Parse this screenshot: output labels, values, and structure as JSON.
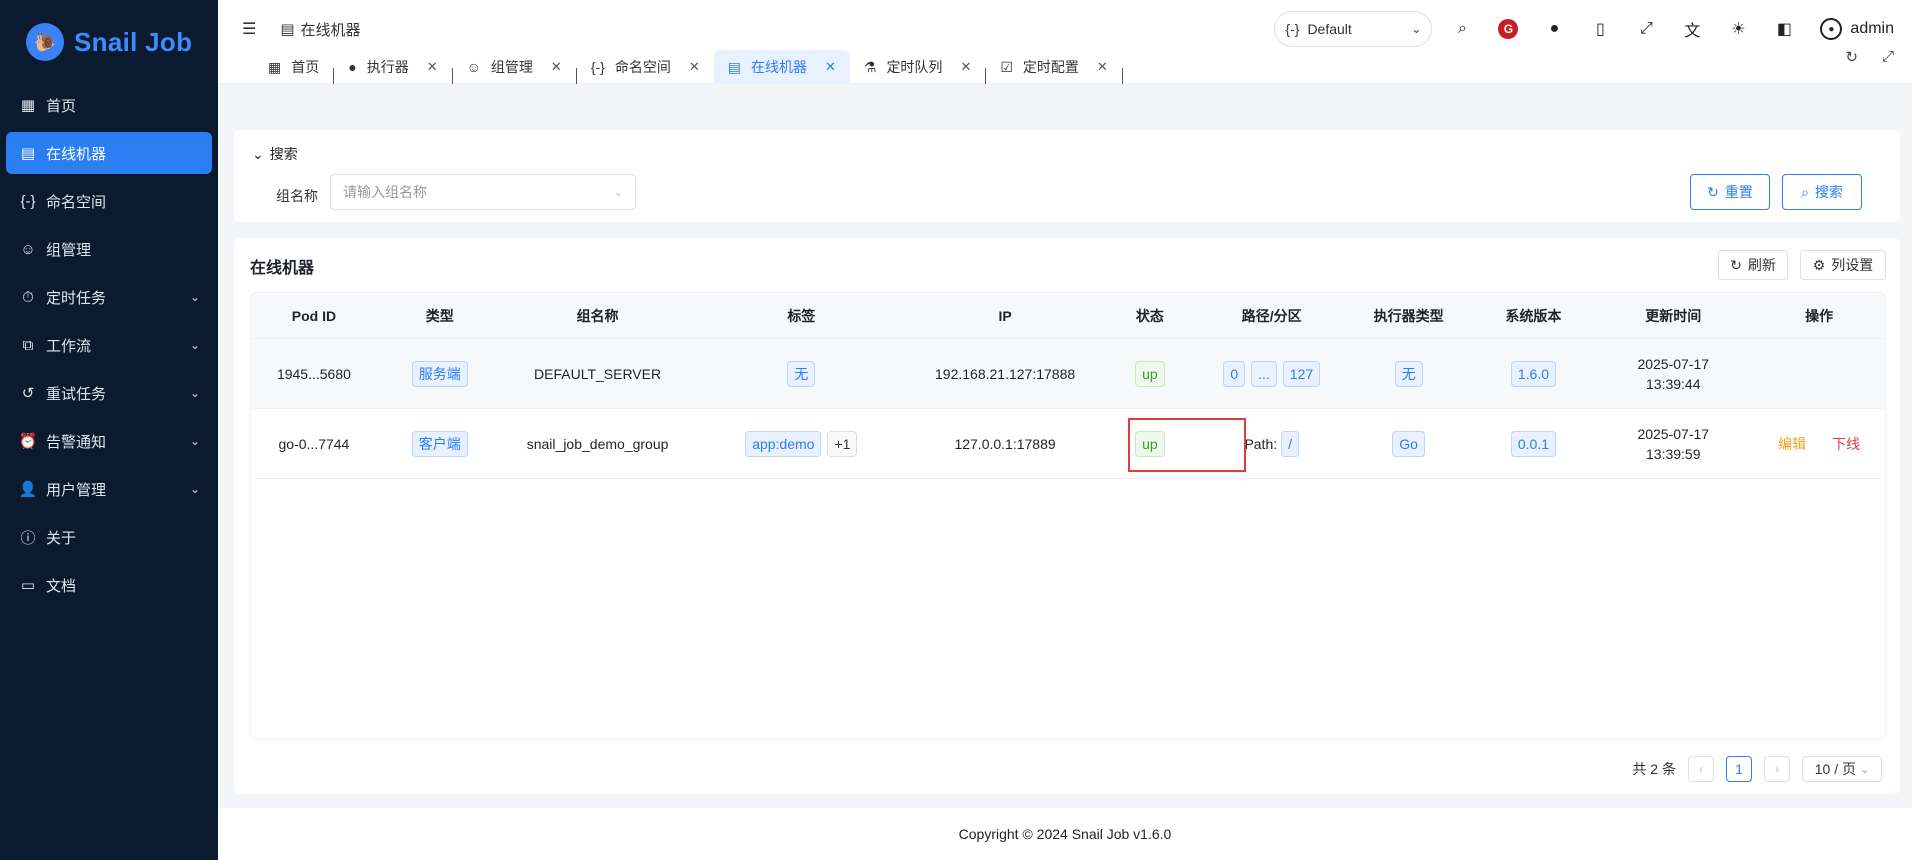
{
  "brand": {
    "name": "Snail Job"
  },
  "sidebar": {
    "items": [
      {
        "label": "首页",
        "icon": "dashboard-icon",
        "active": false,
        "expandable": false
      },
      {
        "label": "在线机器",
        "icon": "server-icon",
        "active": true,
        "expandable": false
      },
      {
        "label": "命名空间",
        "icon": "namespace-icon",
        "active": false,
        "expandable": false
      },
      {
        "label": "组管理",
        "icon": "group-icon",
        "active": false,
        "expandable": false
      },
      {
        "label": "定时任务",
        "icon": "timer-icon",
        "active": false,
        "expandable": true
      },
      {
        "label": "工作流",
        "icon": "workflow-icon",
        "active": false,
        "expandable": true
      },
      {
        "label": "重试任务",
        "icon": "retry-icon",
        "active": false,
        "expandable": true
      },
      {
        "label": "告警通知",
        "icon": "alarm-icon",
        "active": false,
        "expandable": true
      },
      {
        "label": "用户管理",
        "icon": "user-manage-icon",
        "active": false,
        "expandable": true
      },
      {
        "label": "关于",
        "icon": "help-icon",
        "active": false,
        "expandable": false
      },
      {
        "label": "文档",
        "icon": "doc-icon",
        "active": false,
        "expandable": false
      }
    ]
  },
  "header": {
    "breadcrumb": "在线机器",
    "namespace": "Default",
    "user": "admin"
  },
  "tabs": [
    {
      "label": "首页",
      "closable": false,
      "active": false
    },
    {
      "label": "执行器",
      "closable": true,
      "active": false
    },
    {
      "label": "组管理",
      "closable": true,
      "active": false
    },
    {
      "label": "命名空间",
      "closable": true,
      "active": false
    },
    {
      "label": "在线机器",
      "closable": true,
      "active": true
    },
    {
      "label": "定时队列",
      "closable": true,
      "active": false
    },
    {
      "label": "定时配置",
      "closable": true,
      "active": false
    }
  ],
  "search": {
    "title": "搜索",
    "group_label": "组名称",
    "group_placeholder": "请输入组名称",
    "reset_label": "重置",
    "search_label": "搜索"
  },
  "table": {
    "title": "在线机器",
    "refresh_label": "刷新",
    "column_settings_label": "列设置",
    "columns": [
      "Pod ID",
      "类型",
      "组名称",
      "标签",
      "IP",
      "状态",
      "路径/分区",
      "执行器类型",
      "系统版本",
      "更新时间",
      "操作"
    ],
    "rows": [
      {
        "pod_id": "1945...5680",
        "type": "服务端",
        "group": "DEFAULT_SERVER",
        "labels": [
          "无"
        ],
        "labels_extra": "",
        "ip": "192.168.21.127:17888",
        "status": "up",
        "partition": [
          "0",
          "...",
          "127"
        ],
        "path_label": "",
        "executor_type": "无",
        "version": "1.6.0",
        "updated_date": "2025-07-17",
        "updated_time": "13:39:44",
        "edit_label": "",
        "offline_label": ""
      },
      {
        "pod_id": "go-0...7744",
        "type": "客户端",
        "group": "snail_job_demo_group",
        "labels": [
          "app:demo"
        ],
        "labels_extra": "+1",
        "ip": "127.0.0.1:17889",
        "status": "up",
        "partition": [
          "/"
        ],
        "path_label": "Path:",
        "executor_type": "Go",
        "version": "0.0.1",
        "updated_date": "2025-07-17",
        "updated_time": "13:39:59",
        "edit_label": "编辑",
        "offline_label": "下线"
      }
    ]
  },
  "pagination": {
    "total_text": "共 2 条",
    "current_page": "1",
    "page_size": "10 / 页"
  },
  "footer": {
    "copyright": "Copyright © 2024 Snail Job v1.6.0"
  },
  "colors": {
    "primary": "#2a7ef2",
    "sidebar_bg": "#0b1a2e",
    "success": "#3aa02b",
    "warning": "#f0a020",
    "danger": "#e03e3e"
  }
}
